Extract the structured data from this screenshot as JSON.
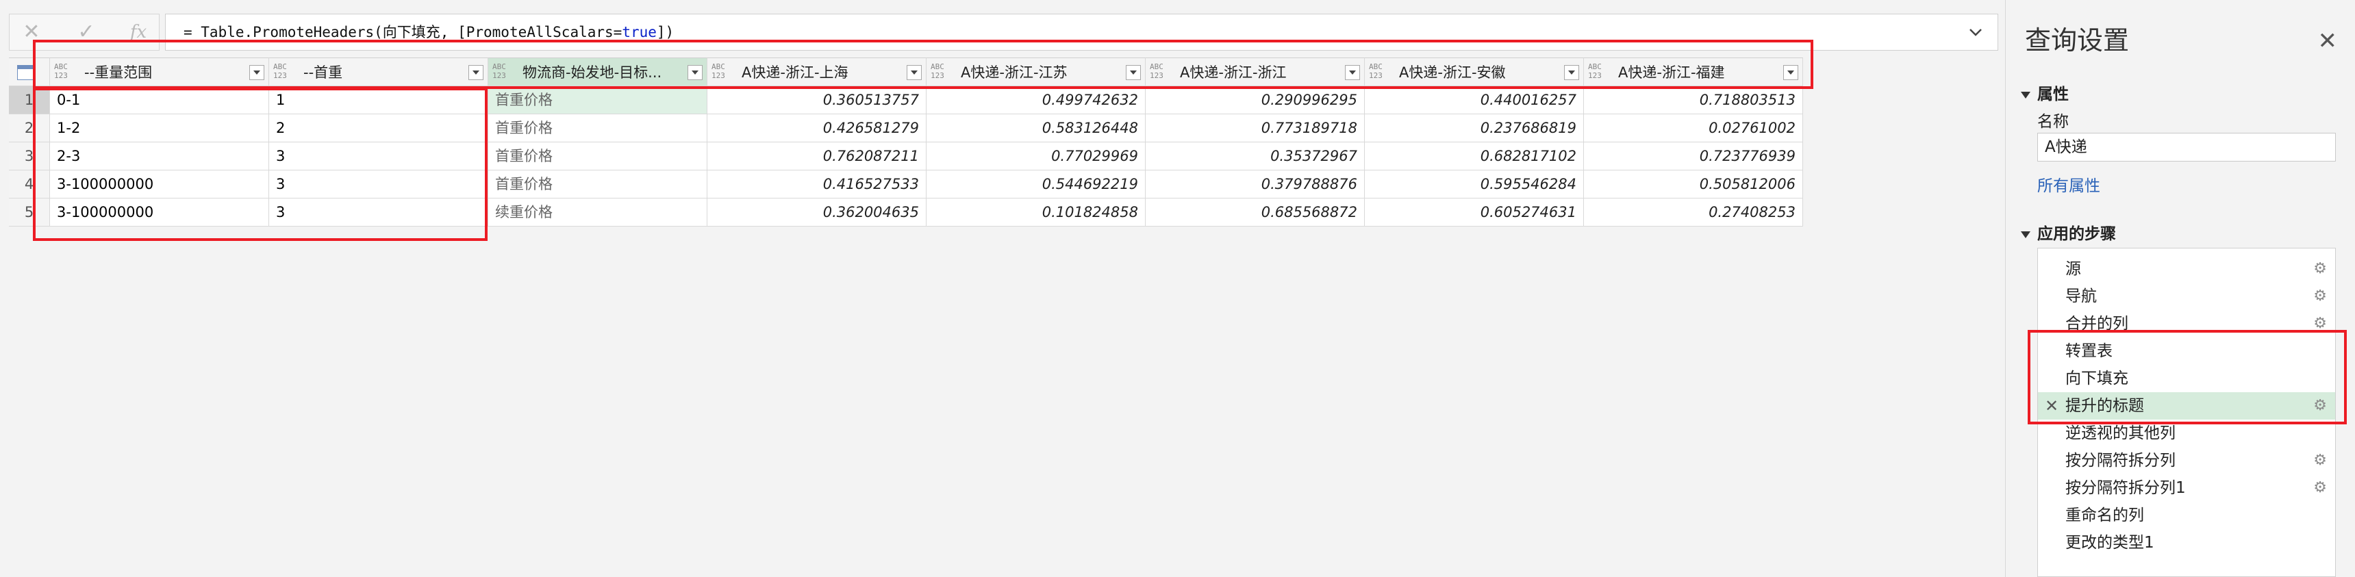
{
  "formula": {
    "cancel_icon": "close-icon",
    "confirm_icon": "check-icon",
    "fx_label": "fx",
    "prefix": "= Table.PromoteHeaders(",
    "table_ref": "向下填充",
    "middle": ", [PromoteAllScalars=",
    "bool_value": "true",
    "suffix": "])"
  },
  "grid": {
    "columns": [
      {
        "type_line1": "ABC",
        "type_line2": "123",
        "name": "--重量范围"
      },
      {
        "type_line1": "ABC",
        "type_line2": "123",
        "name": "--首重"
      },
      {
        "type_line1": "ABC",
        "type_line2": "123",
        "name": "物流商-始发地-目标..."
      },
      {
        "type_line1": "ABC",
        "type_line2": "123",
        "name": "A快递-浙江-上海"
      },
      {
        "type_line1": "ABC",
        "type_line2": "123",
        "name": "A快递-浙江-江苏"
      },
      {
        "type_line1": "ABC",
        "type_line2": "123",
        "name": "A快递-浙江-浙江"
      },
      {
        "type_line1": "ABC",
        "type_line2": "123",
        "name": "A快递-浙江-安徽"
      },
      {
        "type_line1": "ABC",
        "type_line2": "123",
        "name": "A快递-浙江-福建"
      }
    ],
    "rows": [
      {
        "num": "1",
        "cells": [
          "0-1",
          "1",
          "首重价格",
          "0.360513757",
          "0.499742632",
          "0.290996295",
          "0.440016257",
          "0.718803513"
        ]
      },
      {
        "num": "2",
        "cells": [
          "1-2",
          "2",
          "首重价格",
          "0.426581279",
          "0.583126448",
          "0.773189718",
          "0.237686819",
          "0.02761002"
        ]
      },
      {
        "num": "3",
        "cells": [
          "2-3",
          "3",
          "首重价格",
          "0.762087211",
          "0.77029969",
          "0.35372967",
          "0.682817102",
          "0.723776939"
        ]
      },
      {
        "num": "4",
        "cells": [
          "3-100000000",
          "3",
          "首重价格",
          "0.416527533",
          "0.544692219",
          "0.379788876",
          "0.595546284",
          "0.505812006"
        ]
      },
      {
        "num": "5",
        "cells": [
          "3-100000000",
          "3",
          "续重价格",
          "0.362004635",
          "0.101824858",
          "0.685568872",
          "0.605274631",
          "0.27408253"
        ]
      }
    ]
  },
  "settings": {
    "title": "查询设置",
    "properties_header": "属性",
    "name_label": "名称",
    "name_value": "A快递",
    "all_properties": "所有属性",
    "steps_header": "应用的步骤",
    "steps": [
      {
        "label": "源",
        "gear": true,
        "selected": false
      },
      {
        "label": "导航",
        "gear": true,
        "selected": false
      },
      {
        "label": "合并的列",
        "gear": true,
        "selected": false
      },
      {
        "label": "转置表",
        "gear": false,
        "selected": false
      },
      {
        "label": "向下填充",
        "gear": false,
        "selected": false
      },
      {
        "label": "提升的标题",
        "gear": true,
        "selected": true
      },
      {
        "label": "逆透视的其他列",
        "gear": false,
        "selected": false
      },
      {
        "label": "按分隔符拆分列",
        "gear": true,
        "selected": false
      },
      {
        "label": "按分隔符拆分列1",
        "gear": true,
        "selected": false
      },
      {
        "label": "重命名的列",
        "gear": false,
        "selected": false
      },
      {
        "label": "更改的类型1",
        "gear": false,
        "selected": false
      }
    ]
  },
  "colors": {
    "annotation_red": "#ec1c24",
    "selected_green": "#d6ecdc",
    "link_blue": "#2a62b8"
  }
}
